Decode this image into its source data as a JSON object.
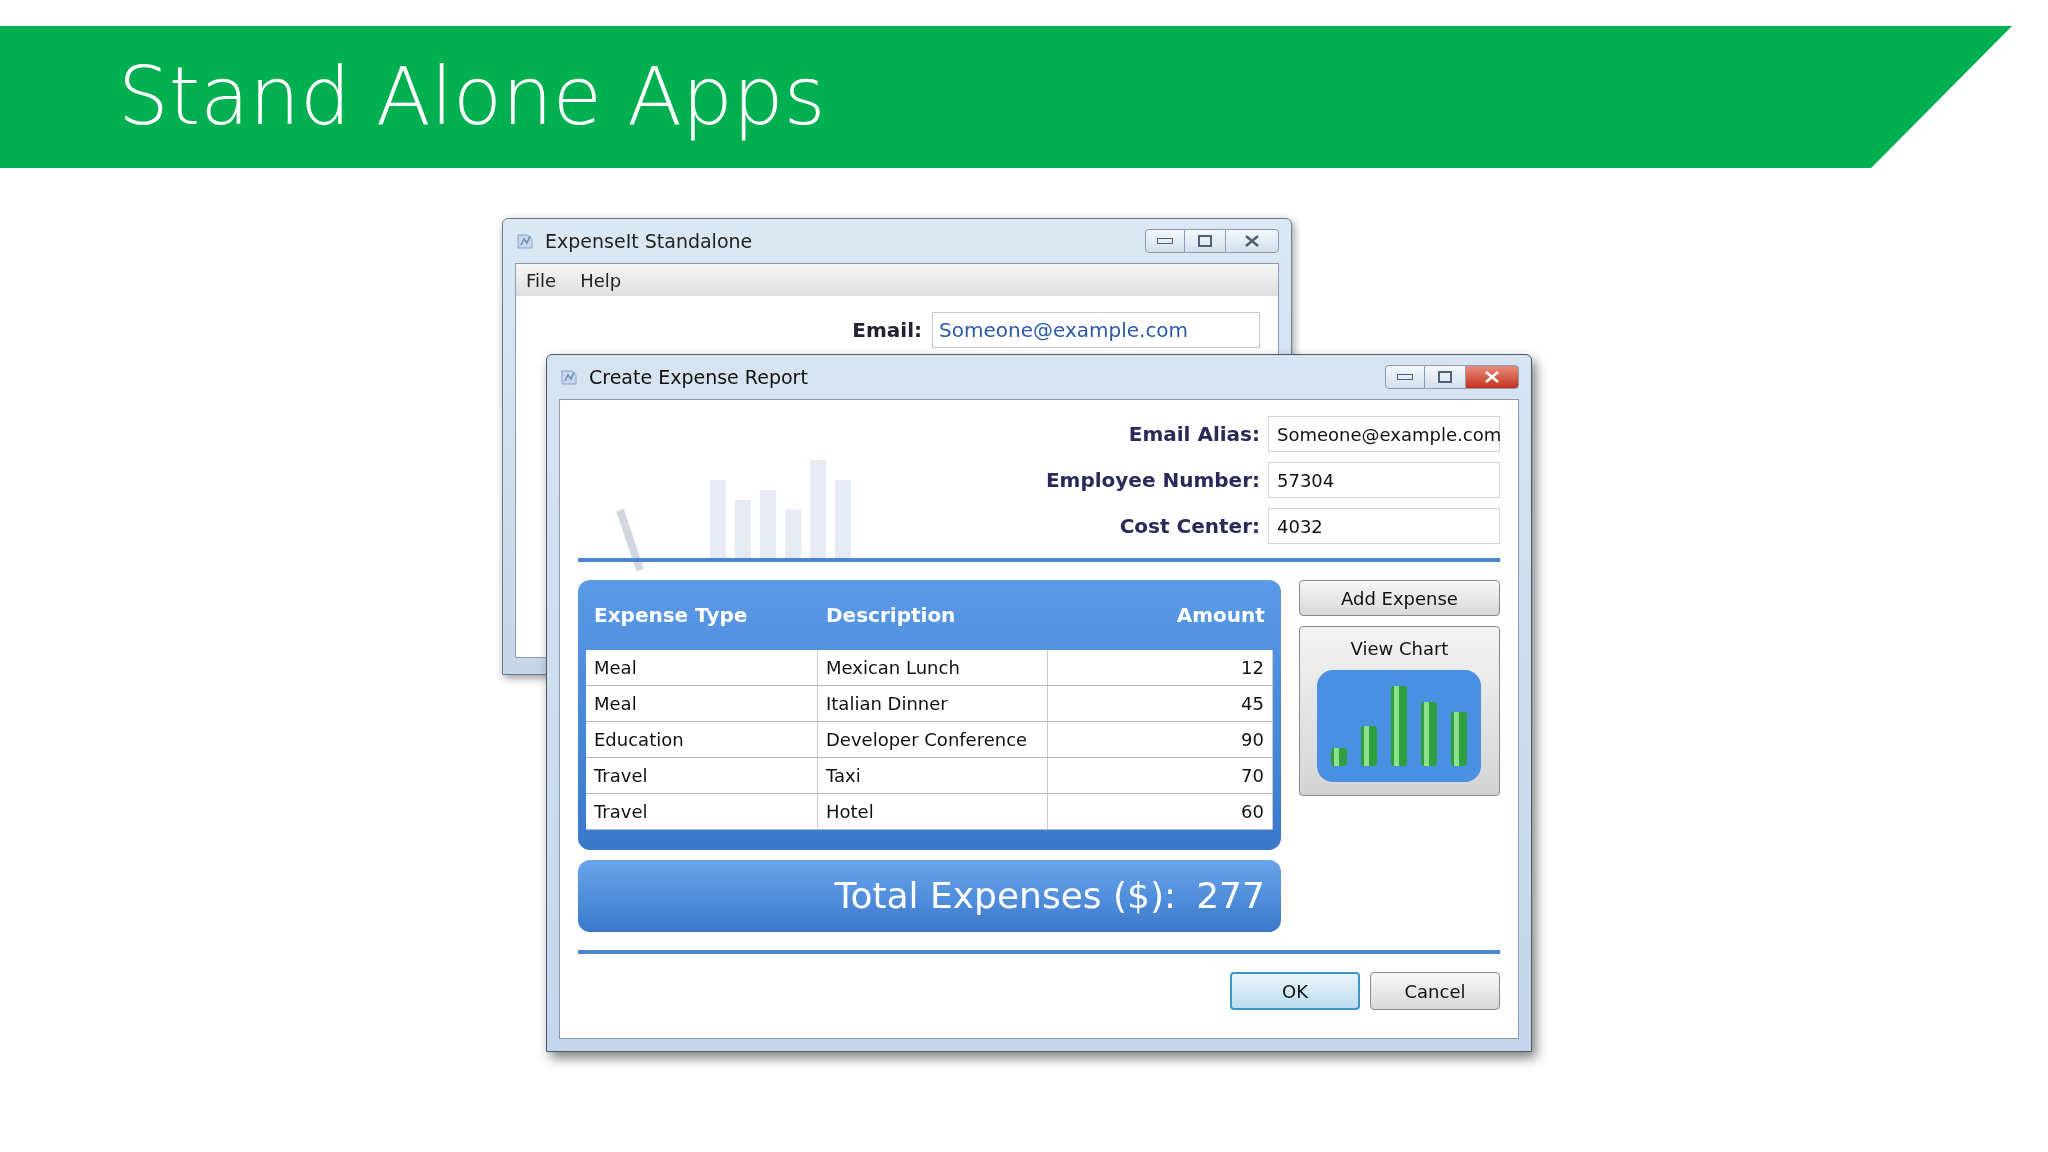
{
  "slide": {
    "title": "Stand Alone Apps"
  },
  "back_window": {
    "title": "ExpenseIt Standalone",
    "menu": [
      "File",
      "Help"
    ],
    "email_label": "Email:",
    "email_value": "Someone@example.com"
  },
  "dialog": {
    "title": "Create Expense Report",
    "fields": [
      {
        "label": "Email Alias:",
        "value": "Someone@example.com"
      },
      {
        "label": "Employee Number:",
        "value": "57304"
      },
      {
        "label": "Cost Center:",
        "value": "4032"
      }
    ],
    "table": {
      "columns": [
        "Expense Type",
        "Description",
        "Amount"
      ],
      "rows": [
        [
          "Meal",
          "Mexican Lunch",
          "12"
        ],
        [
          "Meal",
          "Italian Dinner",
          "45"
        ],
        [
          "Education",
          "Developer Conference",
          "90"
        ],
        [
          "Travel",
          "Taxi",
          "70"
        ],
        [
          "Travel",
          "Hotel",
          "60"
        ]
      ]
    },
    "total_label": "Total Expenses ($):",
    "total_value": "277",
    "add_button": "Add Expense",
    "chart_button": "View Chart",
    "buttons": [
      {
        "label": "OK",
        "kind": "default"
      },
      {
        "label": "Cancel",
        "kind": "normal"
      }
    ]
  }
}
